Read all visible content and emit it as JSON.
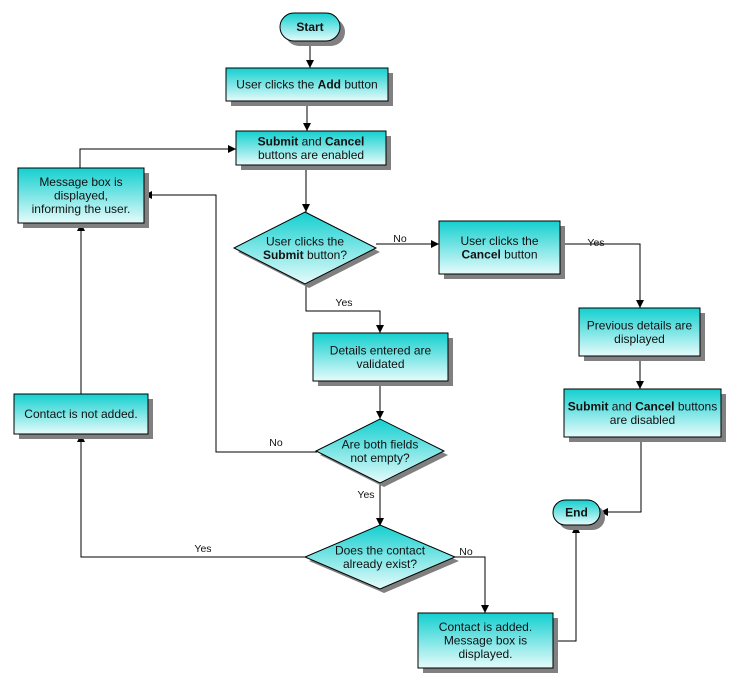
{
  "colors": {
    "fill_top": "#14cfcf",
    "fill_bottom": "#e6fbfb",
    "stroke": "#000000",
    "shadow": "#808080"
  },
  "nodes": [
    {
      "id": "start",
      "type": "terminator",
      "lines": [
        [
          {
            "t": "Start",
            "b": true
          }
        ]
      ]
    },
    {
      "id": "add",
      "type": "process",
      "lines": [
        [
          {
            "t": "User clicks the "
          },
          {
            "t": "Add",
            "b": true
          },
          {
            "t": " button"
          }
        ]
      ]
    },
    {
      "id": "enabled",
      "type": "process",
      "lines": [
        [
          {
            "t": "Submit",
            "b": true
          },
          {
            "t": " and "
          },
          {
            "t": "Cancel",
            "b": true
          }
        ],
        [
          {
            "t": "buttons are enabled"
          }
        ]
      ]
    },
    {
      "id": "submit_q",
      "type": "decision",
      "lines": [
        [
          {
            "t": "User clicks the"
          }
        ],
        [
          {
            "t": "Submit",
            "b": true
          },
          {
            "t": " button?"
          }
        ]
      ]
    },
    {
      "id": "cancel",
      "type": "process",
      "lines": [
        [
          {
            "t": "User clicks the"
          }
        ],
        [
          {
            "t": "Cancel",
            "b": true
          },
          {
            "t": " button"
          }
        ]
      ]
    },
    {
      "id": "previous",
      "type": "process",
      "lines": [
        [
          {
            "t": "Previous details are"
          }
        ],
        [
          {
            "t": "displayed"
          }
        ]
      ]
    },
    {
      "id": "disabled",
      "type": "process",
      "lines": [
        [
          {
            "t": "Submit",
            "b": true
          },
          {
            "t": " and "
          },
          {
            "t": "Cancel",
            "b": true
          },
          {
            "t": " buttons"
          }
        ],
        [
          {
            "t": "are disabled"
          }
        ]
      ]
    },
    {
      "id": "validated",
      "type": "process",
      "lines": [
        [
          {
            "t": "Details entered are"
          }
        ],
        [
          {
            "t": "validated"
          }
        ]
      ]
    },
    {
      "id": "fields_q",
      "type": "decision",
      "lines": [
        [
          {
            "t": "Are both fields"
          }
        ],
        [
          {
            "t": "not empty?"
          }
        ]
      ]
    },
    {
      "id": "exists_q",
      "type": "decision",
      "lines": [
        [
          {
            "t": "Does the contact"
          }
        ],
        [
          {
            "t": "already exist?"
          }
        ]
      ]
    },
    {
      "id": "msgbox",
      "type": "process",
      "lines": [
        [
          {
            "t": "Message box is"
          }
        ],
        [
          {
            "t": "displayed,"
          }
        ],
        [
          {
            "t": "informing the user."
          }
        ]
      ]
    },
    {
      "id": "not_added",
      "type": "process",
      "lines": [
        [
          {
            "t": "Contact is not added."
          }
        ]
      ]
    },
    {
      "id": "added",
      "type": "process",
      "lines": [
        [
          {
            "t": "Contact is added."
          }
        ],
        [
          {
            "t": "Message box is"
          }
        ],
        [
          {
            "t": "displayed."
          }
        ]
      ]
    },
    {
      "id": "end",
      "type": "terminator",
      "lines": [
        [
          {
            "t": "End",
            "b": true
          }
        ]
      ]
    }
  ],
  "edges": [
    {
      "from": "start",
      "to": "add",
      "label": ""
    },
    {
      "from": "add",
      "to": "enabled",
      "label": ""
    },
    {
      "from": "enabled",
      "to": "submit_q",
      "label": ""
    },
    {
      "from": "submit_q",
      "to": "cancel",
      "label": "No"
    },
    {
      "from": "submit_q",
      "to": "validated",
      "label": "Yes"
    },
    {
      "from": "cancel",
      "to": "previous",
      "label": "Yes"
    },
    {
      "from": "previous",
      "to": "disabled",
      "label": ""
    },
    {
      "from": "disabled",
      "to": "end",
      "label": ""
    },
    {
      "from": "validated",
      "to": "fields_q",
      "label": ""
    },
    {
      "from": "fields_q",
      "to": "msgbox",
      "label": "No"
    },
    {
      "from": "fields_q",
      "to": "exists_q",
      "label": "Yes"
    },
    {
      "from": "exists_q",
      "to": "not_added",
      "label": "Yes"
    },
    {
      "from": "exists_q",
      "to": "added",
      "label": "No"
    },
    {
      "from": "not_added",
      "to": "msgbox",
      "label": ""
    },
    {
      "from": "msgbox",
      "to": "enabled",
      "label": ""
    },
    {
      "from": "added",
      "to": "end",
      "label": ""
    }
  ]
}
